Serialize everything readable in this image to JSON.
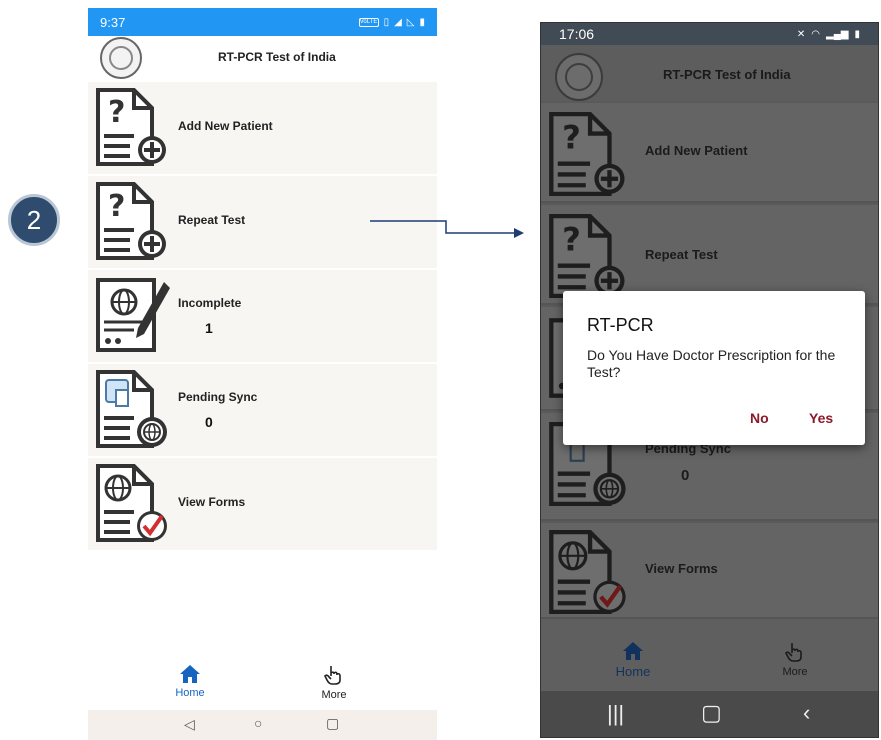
{
  "step": {
    "number": "2"
  },
  "left_phone": {
    "status": {
      "time": "9:37",
      "volte": "VoLTE"
    },
    "app_title": "RT-PCR Test of India",
    "menu": [
      {
        "label": "Add New Patient",
        "count": "",
        "icon": "add-document-icon"
      },
      {
        "label": "Repeat Test",
        "count": "",
        "icon": "add-document-icon"
      },
      {
        "label": "Incomplete",
        "count": "1",
        "icon": "form-globe-pen-icon"
      },
      {
        "label": "Pending Sync",
        "count": "0",
        "icon": "sync-globe-icon"
      },
      {
        "label": "View Forms",
        "count": "",
        "icon": "globe-checkmark-icon"
      }
    ],
    "bottom_nav": {
      "home": "Home",
      "more": "More"
    }
  },
  "right_phone": {
    "status": {
      "time": "17:06"
    },
    "app_title": "RT-PCR Test of India",
    "menu": [
      {
        "label": "Add New Patient",
        "count": ""
      },
      {
        "label": "Repeat Test",
        "count": ""
      },
      {
        "label": "Pending Sync",
        "count": "0"
      },
      {
        "label": "View Forms",
        "count": ""
      }
    ],
    "bottom_nav": {
      "home": "Home",
      "more": "More"
    }
  },
  "dialog": {
    "title": "RT-PCR",
    "message": "Do You Have Doctor Prescription for the Test?",
    "no": "No",
    "yes": "Yes"
  },
  "colors": {
    "status_bar": "#2196f3",
    "home_active": "#1565c0",
    "dialog_button": "#8b1a2b",
    "step_badge": "#2f4b6e"
  }
}
